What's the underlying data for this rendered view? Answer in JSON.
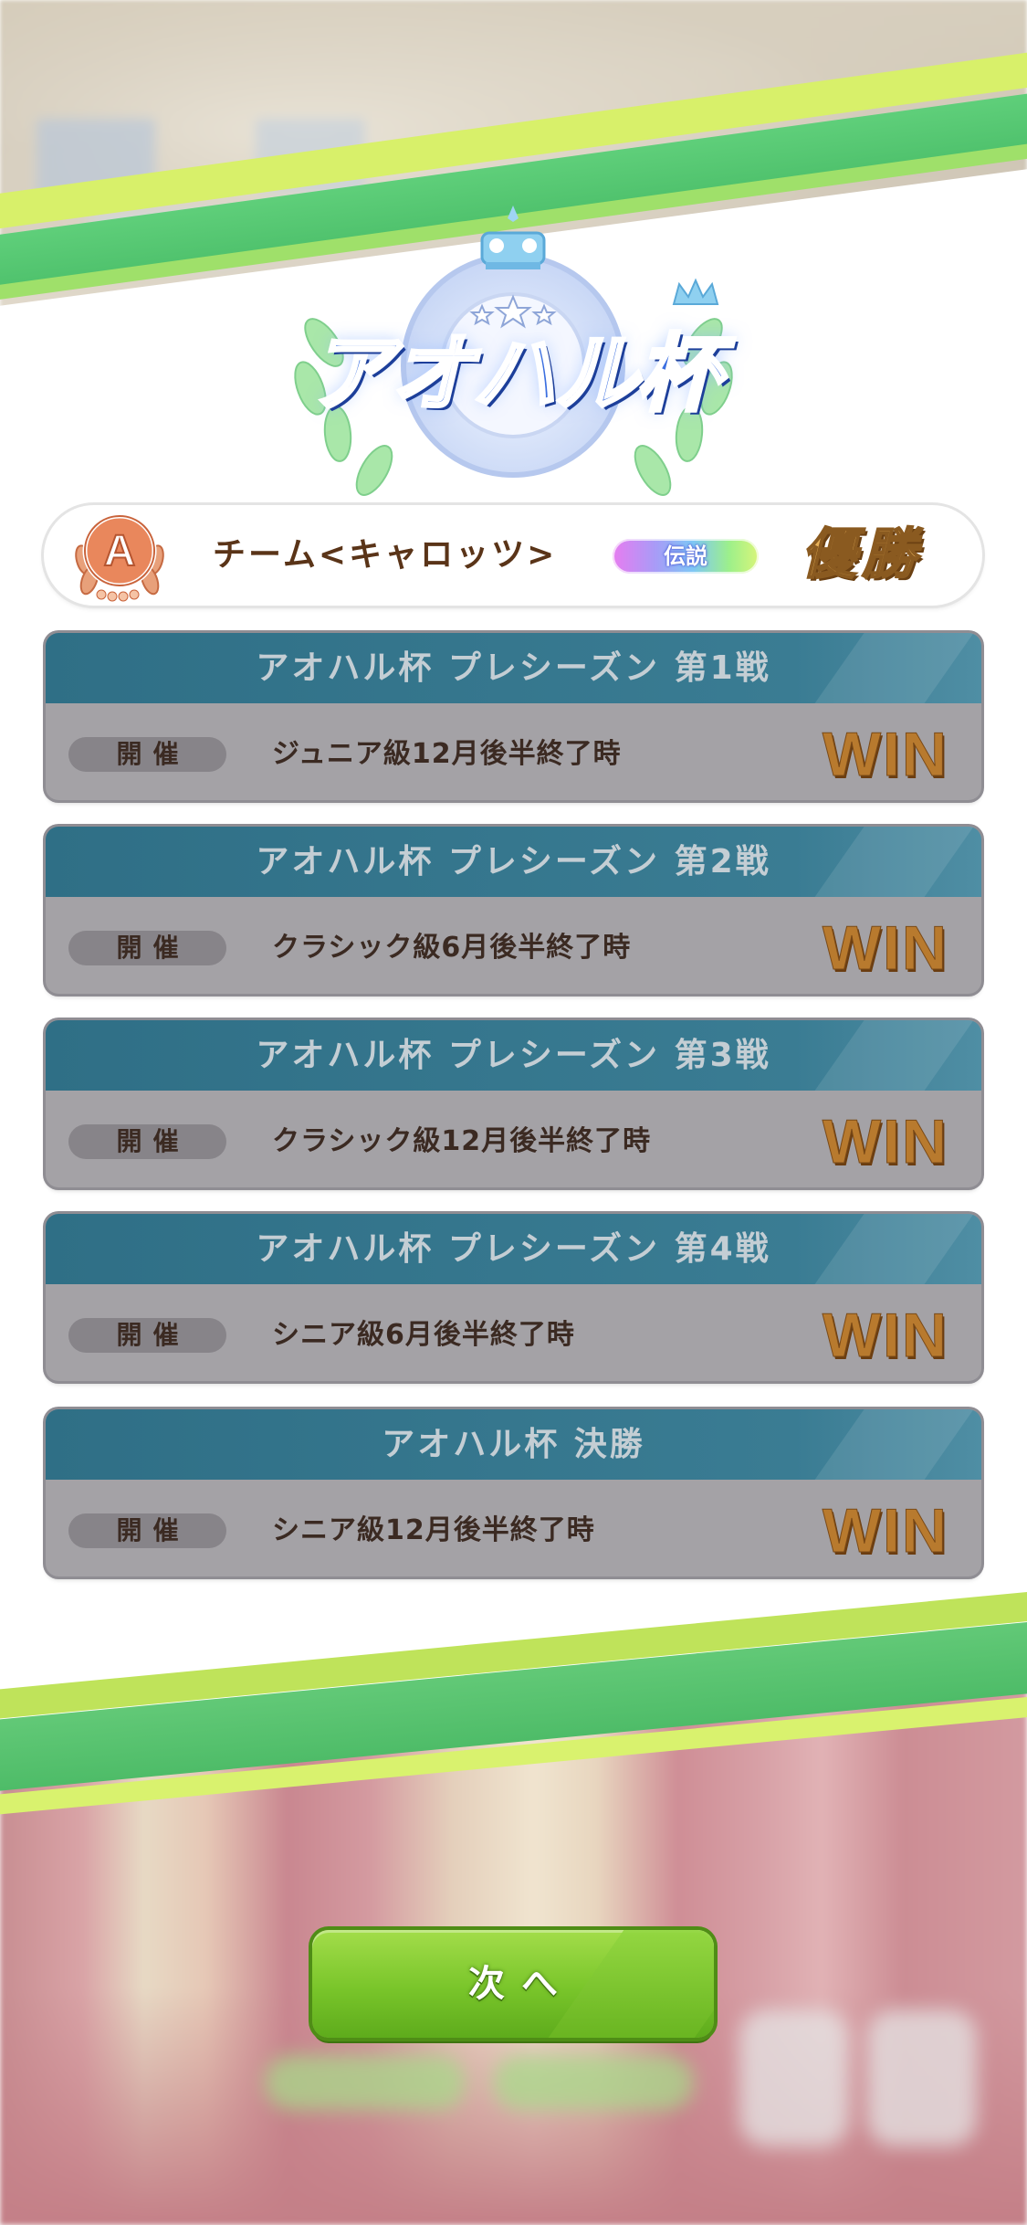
{
  "logo": {
    "title": "アオハル杯"
  },
  "team": {
    "rank": "A",
    "name": "チーム<キャロッツ>",
    "tier_badge": "伝説",
    "result": "優勝"
  },
  "races": [
    {
      "title": "アオハル杯 プレシーズン 第1戦",
      "held_label": "開催",
      "timing": "ジュニア級12月後半終了時",
      "result": "WIN"
    },
    {
      "title": "アオハル杯 プレシーズン 第2戦",
      "held_label": "開催",
      "timing": "クラシック級6月後半終了時",
      "result": "WIN"
    },
    {
      "title": "アオハル杯 プレシーズン 第3戦",
      "held_label": "開催",
      "timing": "クラシック級12月後半終了時",
      "result": "WIN"
    },
    {
      "title": "アオハル杯 プレシーズン 第4戦",
      "held_label": "開催",
      "timing": "シニア級6月後半終了時",
      "result": "WIN"
    },
    {
      "title": "アオハル杯 決勝",
      "held_label": "開催",
      "timing": "シニア級12月後半終了時",
      "result": "WIN"
    }
  ],
  "next_button": {
    "label": "次へ"
  },
  "colors": {
    "accent_green": "#5fcf7a",
    "lime": "#d8f06a",
    "race_header": "#2f6f86",
    "win_gold": "#b87a2e"
  }
}
